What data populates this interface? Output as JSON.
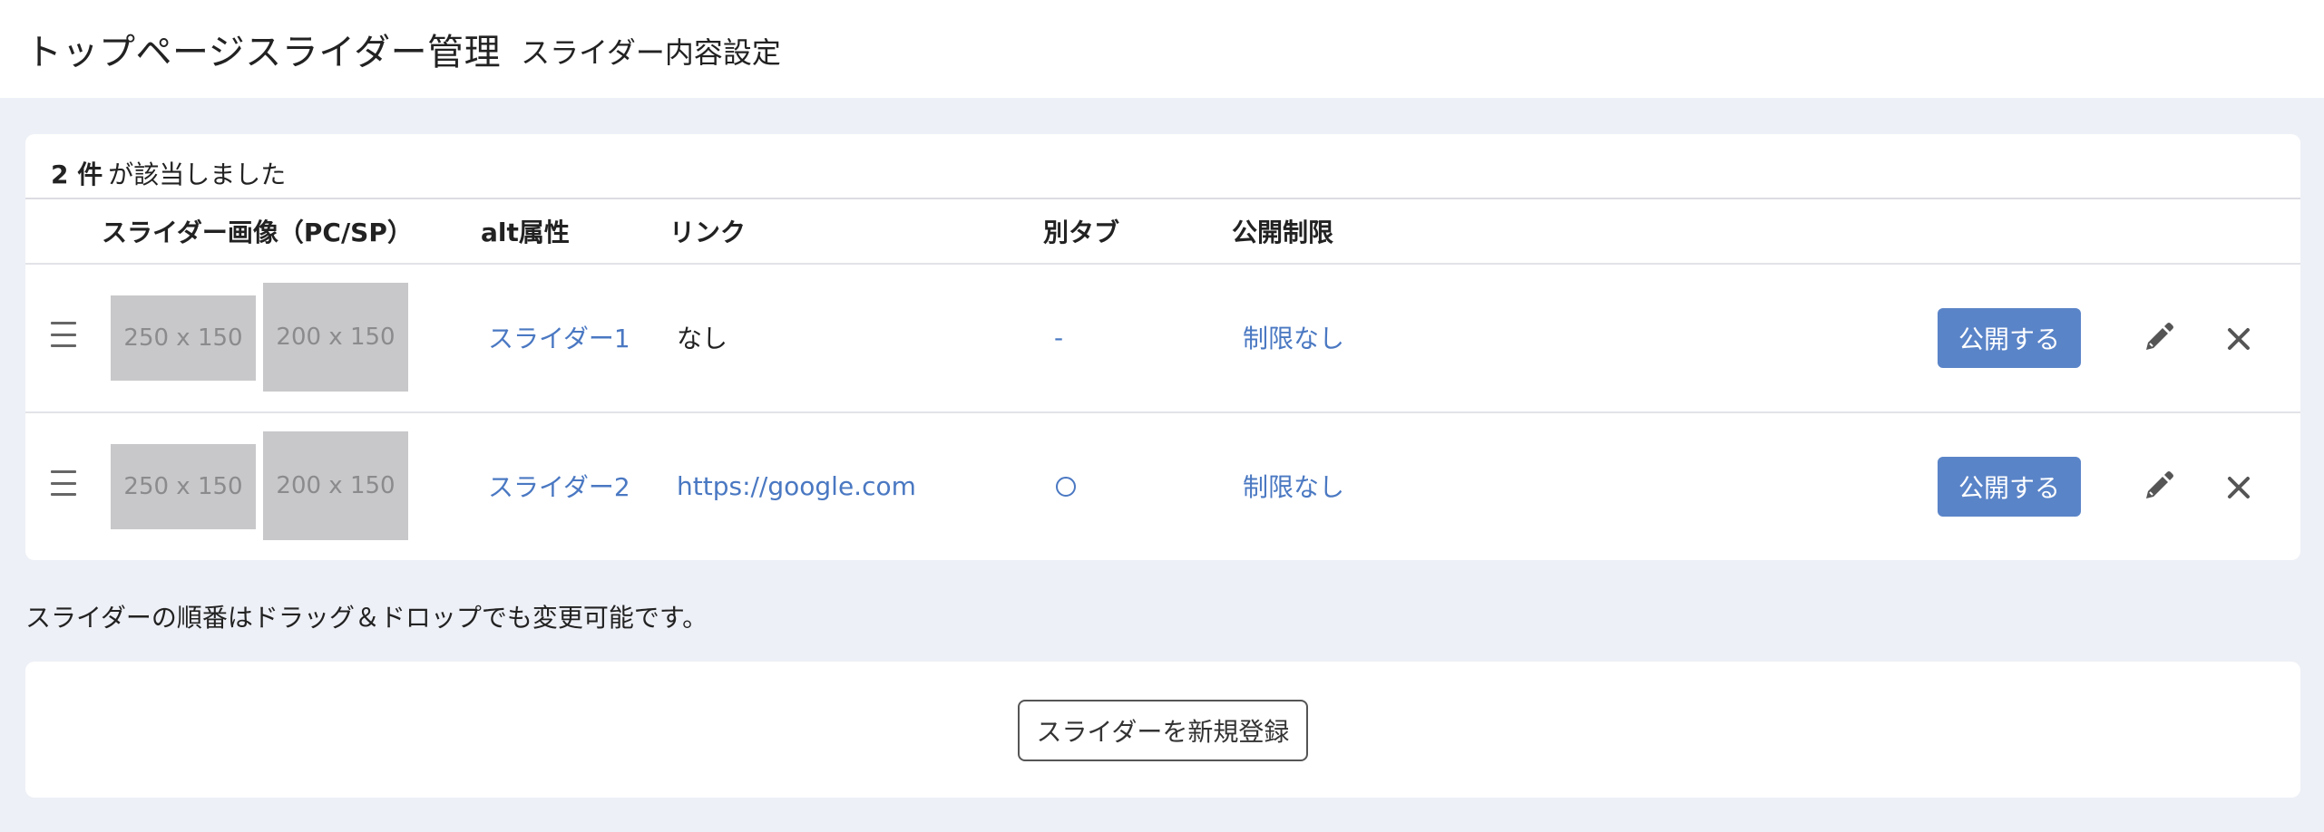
{
  "header": {
    "title": "トップページスライダー管理",
    "subtitle": "スライダー内容設定"
  },
  "result": {
    "count": "2 件",
    "suffix": "が該当しました"
  },
  "table": {
    "columns": {
      "image": "スライダー画像（PC/SP）",
      "alt": "alt属性",
      "link": "リンク",
      "new_tab": "別タブ",
      "limit": "公開制限"
    },
    "rows": [
      {
        "pc_image": "250 x 150",
        "sp_image": "200 x 150",
        "alt": "スライダー1",
        "link": "なし",
        "new_tab": "-",
        "limit": "制限なし",
        "publish_label": "公開する"
      },
      {
        "pc_image": "250 x 150",
        "sp_image": "200 x 150",
        "alt": "スライダー2",
        "link": "https://google.com",
        "new_tab": "circle",
        "limit": "制限なし",
        "publish_label": "公開する"
      }
    ]
  },
  "note": "スライダーの順番はドラッグ＆ドロップでも変更可能です。",
  "actions": {
    "new_label": "スライダーを新規登録"
  },
  "colors": {
    "accent": "#5a84c8",
    "link": "#4a78c2",
    "background": "#eef0f7",
    "placeholder": "#c8c8ca"
  },
  "icons": {
    "drag": "drag-handle-icon",
    "edit": "pencil-icon",
    "delete": "close-icon"
  }
}
